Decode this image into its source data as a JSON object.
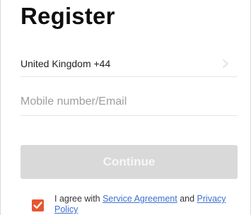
{
  "page": {
    "title": "Register"
  },
  "country": {
    "label": "United Kingdom +44",
    "icon": "chevron-right-icon"
  },
  "mobile": {
    "placeholder": "Mobile number/Email",
    "value": ""
  },
  "continue": {
    "label": "Continue"
  },
  "agreement": {
    "checked": true,
    "prefix": "I agree with ",
    "service_word1": "Service",
    "service_word2": "Agreement",
    "and": " and ",
    "privacy_word1": "Privacy",
    "privacy_word2": "Policy"
  },
  "colors": {
    "accent": "#e6562e",
    "link": "#3d6fd1",
    "button_disabled": "#d9d9d9"
  }
}
